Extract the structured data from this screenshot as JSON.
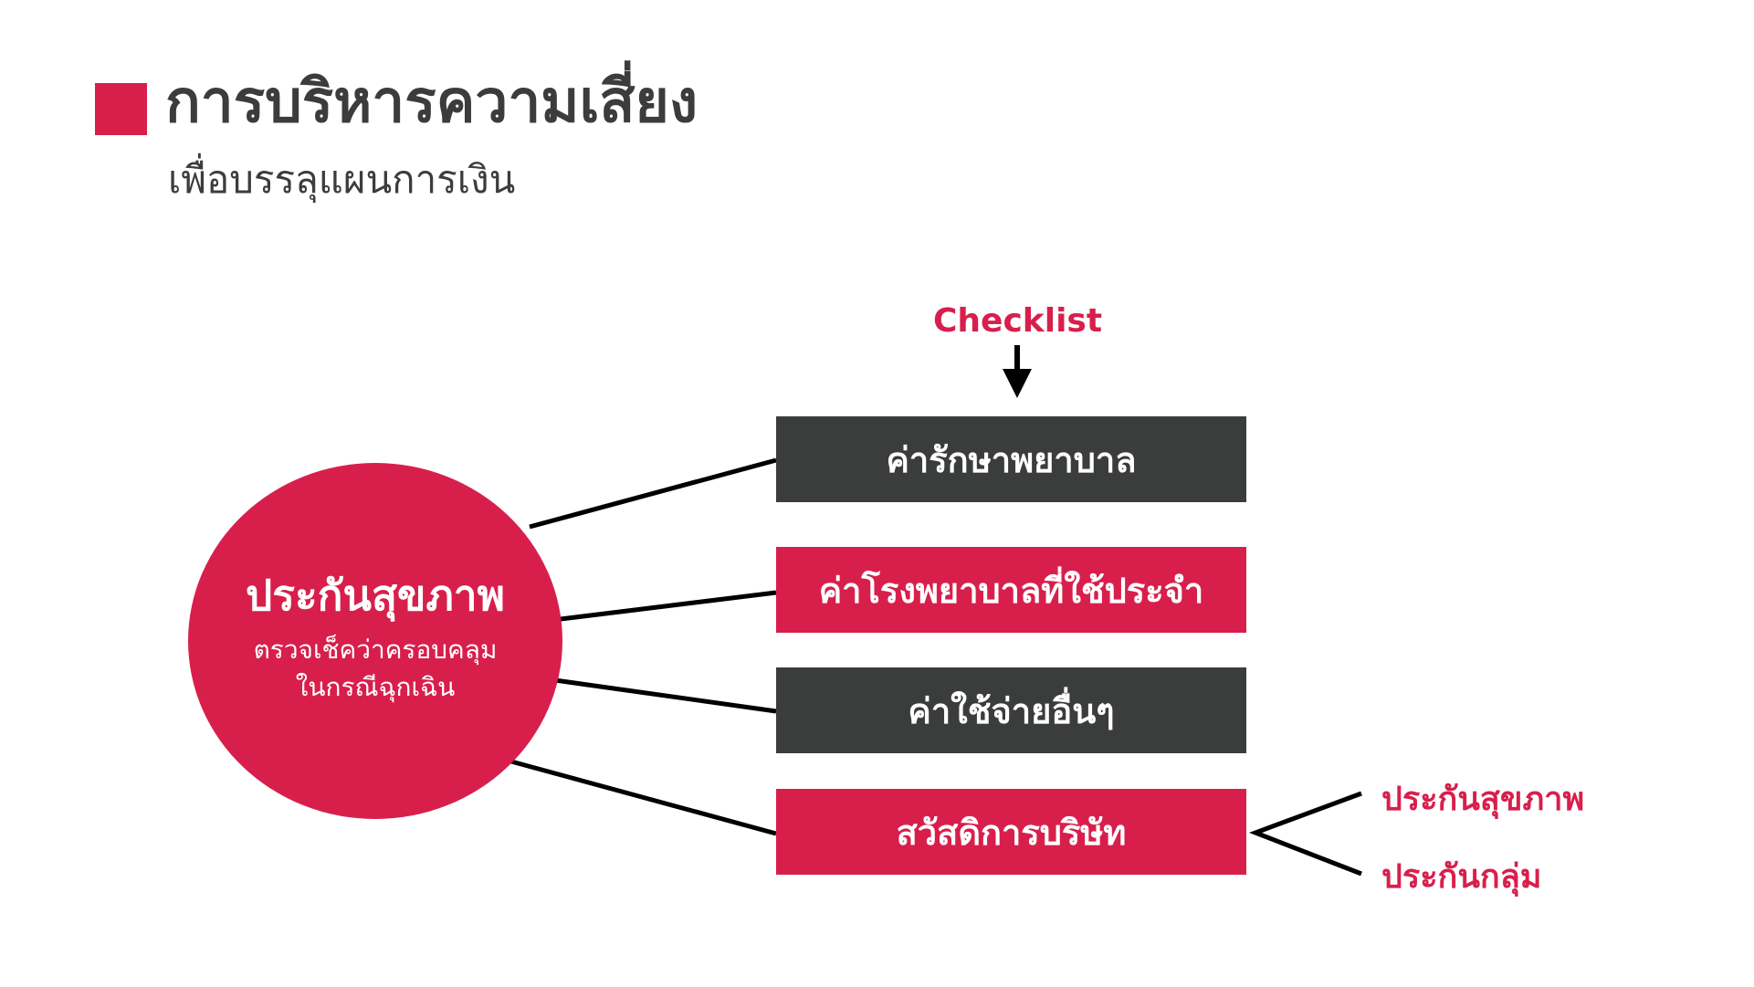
{
  "header": {
    "title": "การบริหารความเสี่ยง",
    "subtitle": "เพื่อบรรลุแผนการเงิน"
  },
  "hub": {
    "title": "ประกันสุขภาพ",
    "note_line1": "ตรวจเช็คว่าครอบคลุม",
    "note_line2": "ในกรณีฉุกเฉิน"
  },
  "checklist": {
    "label": "Checklist"
  },
  "items": [
    {
      "label": "ค่ารักษาพยาบาล"
    },
    {
      "label": "ค่าโรงพยาบาลที่ใช้ประจำ"
    },
    {
      "label": "ค่าใช้จ่ายอื่นๆ"
    },
    {
      "label": "สวัสดิการบริษัท"
    }
  ],
  "benefits": [
    {
      "label": "ประกันสุขภาพ"
    },
    {
      "label": "ประกันกลุ่ม"
    }
  ],
  "colors": {
    "accent": "#d81f4c",
    "dark": "#3b3d3c",
    "background": "#ffffff"
  }
}
